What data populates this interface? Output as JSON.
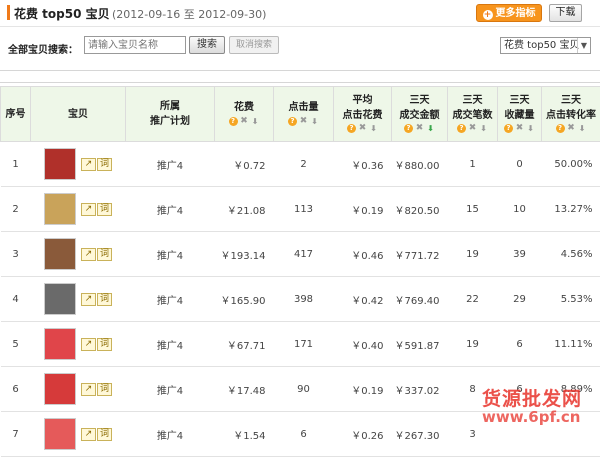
{
  "header": {
    "title": "花费  top50 宝贝",
    "date_range": "(2012-09-16 至 2012-09-30)",
    "more_metrics_label": "更多指标",
    "download_label": "下载"
  },
  "search": {
    "label": "全部宝贝搜索：",
    "placeholder": "请输入宝贝名称",
    "search_label": "搜索",
    "cancel_label": "取消搜索",
    "sort_selected": "花费 top50 宝贝"
  },
  "table": {
    "headers": {
      "index": "序号",
      "item": "宝贝",
      "plan_l1": "所属",
      "plan_l2": "推广计划",
      "cost": "花费",
      "clicks": "点击量",
      "avg_l1": "平均",
      "avg_l2": "点击花费",
      "gmv_l1": "三天",
      "gmv_l2": "成交金额",
      "orders_l1": "三天",
      "orders_l2": "成交笔数",
      "fav_l1": "三天",
      "fav_l2": "收藏量",
      "cvr_l1": "三天",
      "cvr_l2": "点击转化率"
    },
    "row_labels": {
      "word_btn": "词",
      "trend_icon": "trend-icon"
    },
    "rows": [
      {
        "index": "1",
        "plan": "推广4",
        "cost": "￥0.72",
        "clicks": "2",
        "avg": "￥0.36",
        "gmv": "￥880.00",
        "orders": "1",
        "fav": "0",
        "cvr": "50.00%"
      },
      {
        "index": "2",
        "plan": "推广4",
        "cost": "￥21.08",
        "clicks": "113",
        "avg": "￥0.19",
        "gmv": "￥820.50",
        "orders": "15",
        "fav": "10",
        "cvr": "13.27%"
      },
      {
        "index": "3",
        "plan": "推广4",
        "cost": "￥193.14",
        "clicks": "417",
        "avg": "￥0.46",
        "gmv": "￥771.72",
        "orders": "19",
        "fav": "39",
        "cvr": "4.56%"
      },
      {
        "index": "4",
        "plan": "推广4",
        "cost": "￥165.90",
        "clicks": "398",
        "avg": "￥0.42",
        "gmv": "￥769.40",
        "orders": "22",
        "fav": "29",
        "cvr": "5.53%"
      },
      {
        "index": "5",
        "plan": "推广4",
        "cost": "￥67.71",
        "clicks": "171",
        "avg": "￥0.40",
        "gmv": "￥591.87",
        "orders": "19",
        "fav": "6",
        "cvr": "11.11%"
      },
      {
        "index": "6",
        "plan": "推广4",
        "cost": "￥17.48",
        "clicks": "90",
        "avg": "￥0.19",
        "gmv": "￥337.02",
        "orders": "8",
        "fav": "6",
        "cvr": "8.89%"
      },
      {
        "index": "7",
        "plan": "推广4",
        "cost": "￥1.54",
        "clicks": "6",
        "avg": "￥0.26",
        "gmv": "￥267.30",
        "orders": "3",
        "fav": "",
        "cvr": ""
      }
    ]
  },
  "thumb_colors": [
    "#b0302a",
    "#c9a35a",
    "#8a5a3a",
    "#6a6a6a",
    "#e0454a",
    "#d63a3a",
    "#e55a5a"
  ],
  "watermark": {
    "line1": "货源批发网",
    "line2": "www.6pf.cn"
  }
}
